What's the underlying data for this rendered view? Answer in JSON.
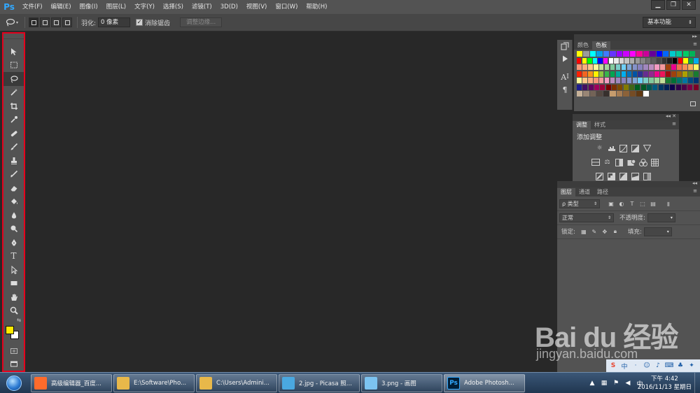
{
  "app": {
    "logo": "Ps",
    "menus": [
      "文件(F)",
      "编辑(E)",
      "图像(I)",
      "图层(L)",
      "文字(Y)",
      "选择(S)",
      "滤镜(T)",
      "3D(D)",
      "视图(V)",
      "窗口(W)",
      "帮助(H)"
    ],
    "window_controls": [
      "▁",
      "❐",
      "✕"
    ]
  },
  "options_bar": {
    "feather_label": "羽化:",
    "feather_value": "0 像素",
    "antialias_checked": true,
    "antialias_label": "消除锯齿",
    "refine_edge_label": "调整边缘...",
    "workspace": "基本功能"
  },
  "toolbar": {
    "highlight_color": "#e4001c",
    "foreground_color": "#ffea00",
    "background_color": "#ffffff",
    "tools": [
      "move-tool",
      "marquee-tool",
      "lasso-tool",
      "magic-wand-tool",
      "crop-tool",
      "eyedropper-tool",
      "spot-healing-tool",
      "brush-tool",
      "clone-stamp-tool",
      "history-brush-tool",
      "eraser-tool",
      "paint-bucket-tool",
      "blur-tool",
      "dodge-tool",
      "pen-tool",
      "type-tool",
      "path-selection-tool",
      "rectangle-tool",
      "hand-tool",
      "zoom-tool"
    ],
    "type_tool_label": "T"
  },
  "swatches_panel": {
    "tabs": [
      "颜色",
      "色板"
    ],
    "active_tab": "色板",
    "rows": [
      [
        "#ffff00",
        "#9b9b9b",
        "#00ffff",
        "#00a0e9",
        "#3f7bff",
        "#6633ff",
        "#9900ff",
        "#cc00ff",
        "#ff00ff",
        "#ff0099",
        "#cc0099",
        "#660099",
        "#0000ff",
        "#0066ff",
        "#00cccc",
        "#00cc99",
        "#00cc66",
        "#00b359"
      ],
      [
        "#ff0000",
        "#ffff00",
        "#00ff00",
        "#00ffff",
        "#0000ff",
        "#ff00ff",
        "#ffffff",
        "#ebebeb",
        "#d6d6d6",
        "#c2c2c2",
        "#adadad",
        "#999999",
        "#858585",
        "#707070",
        "#5c5c5c",
        "#474747",
        "#333333",
        "#1f1f1f",
        "#000000",
        "#ff0000",
        "#ffff00",
        "#00a651",
        "#00aeef"
      ],
      [
        "#f7977a",
        "#f9ad81",
        "#fdc68a",
        "#fff79a",
        "#c4df9b",
        "#a3d39c",
        "#82ca9d",
        "#7bcdc8",
        "#6ecff6",
        "#7ea7d8",
        "#8493ca",
        "#8882be",
        "#a187be",
        "#bc8dbf",
        "#f49ac2",
        "#f6989d",
        "#a0410d",
        "#ec008c",
        "#f26c4f",
        "#f68e56",
        "#fbaf5d",
        "#fff467"
      ],
      [
        "#ff2000",
        "#f26522",
        "#f7941d",
        "#fff200",
        "#8dc73f",
        "#39b54a",
        "#00a651",
        "#00a99d",
        "#00aeef",
        "#0072bc",
        "#0054a6",
        "#2e3192",
        "#662d91",
        "#92278f",
        "#ec008c",
        "#ed145b",
        "#9e0b0f",
        "#a0410d",
        "#a36209",
        "#aba000",
        "#598527",
        "#197b30"
      ],
      [
        "#fff799",
        "#fdc689",
        "#f9ad81",
        "#f7977a",
        "#f6989d",
        "#f49ac2",
        "#bc8dbf",
        "#a187be",
        "#8882be",
        "#8493ca",
        "#7ea7d8",
        "#6ecff6",
        "#7bcdc8",
        "#82ca9d",
        "#a3d39c",
        "#c4df9b",
        "#1a7b30",
        "#007236",
        "#00746b",
        "#0076a3",
        "#004a80",
        "#003471"
      ],
      [
        "#1d1d8f",
        "#440e62",
        "#630460",
        "#9e005d",
        "#9e0039",
        "#790000",
        "#7b2e00",
        "#7d4900",
        "#827b00",
        "#406618",
        "#005e20",
        "#005826",
        "#005952",
        "#005b7f",
        "#003663",
        "#002157",
        "#0d004c",
        "#32004b",
        "#4b0049",
        "#7b0046",
        "#7a0026"
      ],
      [
        "#c7b299",
        "#998675",
        "#736357",
        "#534741",
        "#37302d",
        "#c69c6d",
        "#a67c52",
        "#8c6239",
        "#754c24",
        "#603913",
        "#ffffff"
      ]
    ]
  },
  "adjustments_panel": {
    "tabs": [
      "调整",
      "样式"
    ],
    "active_tab": "调整",
    "title": "添加调整",
    "rows": [
      [
        "brightness-icon",
        "levels-icon",
        "curves-icon",
        "exposure-icon",
        "vibrance-icon"
      ],
      [
        "hue-sat-icon",
        "color-balance-icon",
        "bw-icon",
        "photo-filter-icon",
        "channel-mixer-icon",
        "color-lookup-icon"
      ],
      [
        "invert-icon",
        "posterize-icon",
        "threshold-icon",
        "gradient-map-icon",
        "selective-color-icon"
      ]
    ]
  },
  "layers_panel": {
    "tabs": [
      "图层",
      "通道",
      "路径"
    ],
    "active_tab": "图层",
    "filter_kind": "ρ 类型",
    "blend_mode": "正常",
    "opacity_label": "不透明度:",
    "lock_label": "锁定:",
    "fill_label": "填充:"
  },
  "watermark": {
    "main": "Bai du 经验",
    "sub": "jingyan.baidu.com"
  },
  "taskbar": {
    "items": [
      {
        "label": "高级编辑器_百度...",
        "icon_color": "#ff6b2b"
      },
      {
        "label": "E:\\Software\\Pho...",
        "icon_color": "#e8b84a"
      },
      {
        "label": "C:\\Users\\Admini...",
        "icon_color": "#e8b84a"
      },
      {
        "label": "2.jpg - Picasa 照...",
        "icon_color": "#4aa8e0"
      },
      {
        "label": "3.png - 画图",
        "icon_color": "#7cc3f0"
      },
      {
        "label": "Adobe Photosh...",
        "icon_color": "#001e36"
      }
    ],
    "clock_time": "下午 4:42",
    "clock_date": "2016/11/13 星期日"
  }
}
